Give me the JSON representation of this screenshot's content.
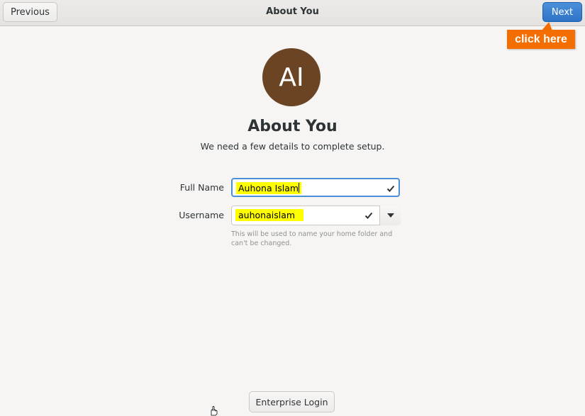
{
  "header": {
    "title": "About You",
    "previous_label": "Previous",
    "next_label": "Next"
  },
  "annotation": {
    "callout_text": "click here",
    "color": "#f46d00"
  },
  "avatar": {
    "initials": "AI",
    "color": "#6b4423"
  },
  "page": {
    "heading": "About You",
    "subtitle": "We need a few details to complete setup."
  },
  "form": {
    "full_name_label": "Full Name",
    "full_name_value": "Auhona Islam",
    "username_label": "Username",
    "username_value": "auhonaislam",
    "username_hint": "This will be used to name your home folder and can't be changed."
  },
  "footer": {
    "enterprise_login_label": "Enterprise Login"
  },
  "icons": {
    "valid": "check-icon",
    "dropdown": "chevron-down-icon",
    "pointer": "hand-cursor-icon"
  },
  "colors": {
    "accent": "#3584e4",
    "highlight": "#ffff00"
  }
}
